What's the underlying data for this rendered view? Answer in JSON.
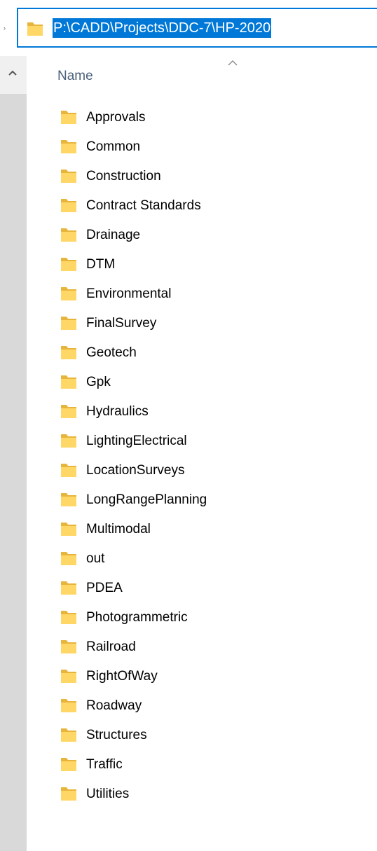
{
  "address_bar": {
    "path": "P:\\CADD\\Projects\\DDC-7\\HP-2020",
    "icon": "folder-icon"
  },
  "column_header": {
    "label": "Name",
    "sort_icon": "chevron-up-icon"
  },
  "nav_pane": {
    "scroll_up_icon": "chevron-up-icon"
  },
  "colors": {
    "accent": "#0078d7",
    "folder": "#ffd766",
    "folder_tab": "#e8b53c",
    "header_text": "#4c607a"
  },
  "folders": [
    "Approvals",
    "Common",
    "Construction",
    "Contract Standards",
    "Drainage",
    "DTM",
    "Environmental",
    "FinalSurvey",
    "Geotech",
    "Gpk",
    "Hydraulics",
    "LightingElectrical",
    "LocationSurveys",
    "LongRangePlanning",
    "Multimodal",
    "out",
    "PDEA",
    "Photogrammetric",
    "Railroad",
    "RightOfWay",
    "Roadway",
    "Structures",
    "Traffic",
    "Utilities"
  ]
}
